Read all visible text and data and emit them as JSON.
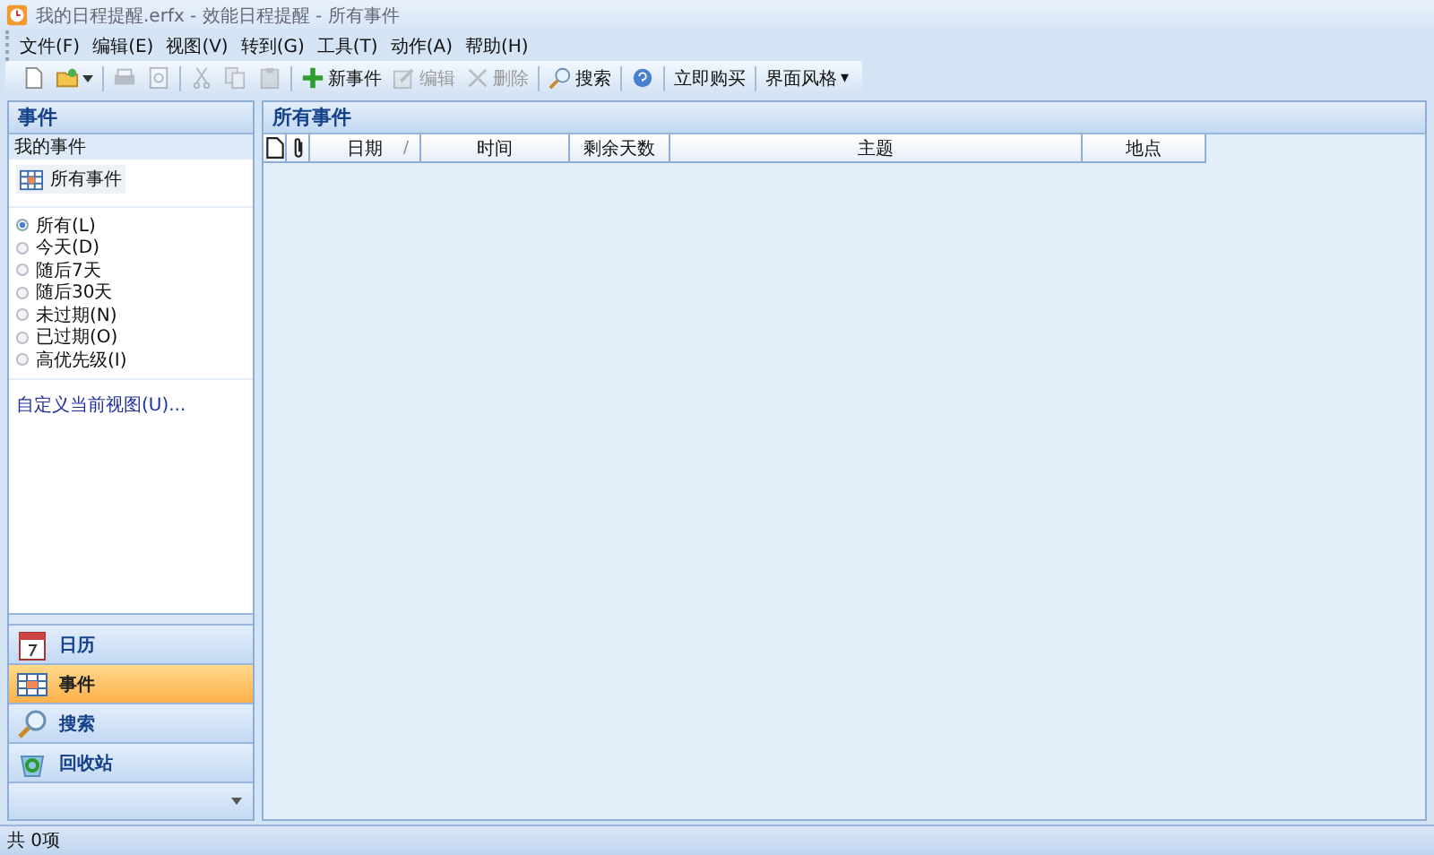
{
  "window": {
    "title": "我的日程提醒.erfx - 效能日程提醒 - 所有事件"
  },
  "menu": [
    "文件(F)",
    "编辑(E)",
    "视图(V)",
    "转到(G)",
    "工具(T)",
    "动作(A)",
    "帮助(H)"
  ],
  "toolbar": [
    {
      "kind": "icon",
      "disabled": false
    },
    {
      "kind": "dropdown-icon",
      "disabled": false
    },
    {
      "kind": "sep"
    },
    {
      "kind": "icon",
      "disabled": true
    },
    {
      "kind": "icon",
      "disabled": true
    },
    {
      "kind": "sep"
    },
    {
      "kind": "icon",
      "disabled": true
    },
    {
      "kind": "icon",
      "disabled": true
    },
    {
      "kind": "icon",
      "disabled": true
    },
    {
      "kind": "sep"
    },
    {
      "kind": "labeled",
      "label": "新事件",
      "disabled": false
    },
    {
      "kind": "labeled",
      "label": "编辑",
      "disabled": true
    },
    {
      "kind": "labeled",
      "label": "删除",
      "disabled": true
    },
    {
      "kind": "sep"
    },
    {
      "kind": "labeled",
      "label": "搜索",
      "disabled": false
    },
    {
      "kind": "sep"
    },
    {
      "kind": "icon",
      "disabled": false
    },
    {
      "kind": "sep"
    },
    {
      "kind": "text",
      "label": "立即购买",
      "disabled": false
    },
    {
      "kind": "sep"
    },
    {
      "kind": "dropdown-text",
      "label": "界面风格",
      "caret": "▾",
      "disabled": false
    }
  ],
  "sidebar": {
    "title": "事件",
    "section": "我的事件",
    "view": "所有事件",
    "filters": [
      {
        "label": "所有(L)",
        "selected": true
      },
      {
        "label": "今天(D)",
        "selected": false
      },
      {
        "label": "随后7天",
        "selected": false
      },
      {
        "label": "随后30天",
        "selected": false
      },
      {
        "label": "未过期(N)",
        "selected": false
      },
      {
        "label": "已过期(O)",
        "selected": false
      },
      {
        "label": "高优先级(I)",
        "selected": false
      }
    ],
    "custom_link": "自定义当前视图(U)...",
    "nav": [
      {
        "label": "日历",
        "selected": false
      },
      {
        "label": "事件",
        "selected": true
      },
      {
        "label": "搜索",
        "selected": false
      },
      {
        "label": "回收站",
        "selected": false
      }
    ]
  },
  "main": {
    "title": "所有事件",
    "columns": [
      {
        "kind": "doc-icon"
      },
      {
        "kind": "clip-icon"
      },
      {
        "kind": "text",
        "label": "日期",
        "sort": "/"
      },
      {
        "kind": "text",
        "label": "时间"
      },
      {
        "kind": "text",
        "label": "剩余天数"
      },
      {
        "kind": "text",
        "label": "主题"
      },
      {
        "kind": "text",
        "label": "地点"
      }
    ]
  },
  "status_bar": "共 0项"
}
